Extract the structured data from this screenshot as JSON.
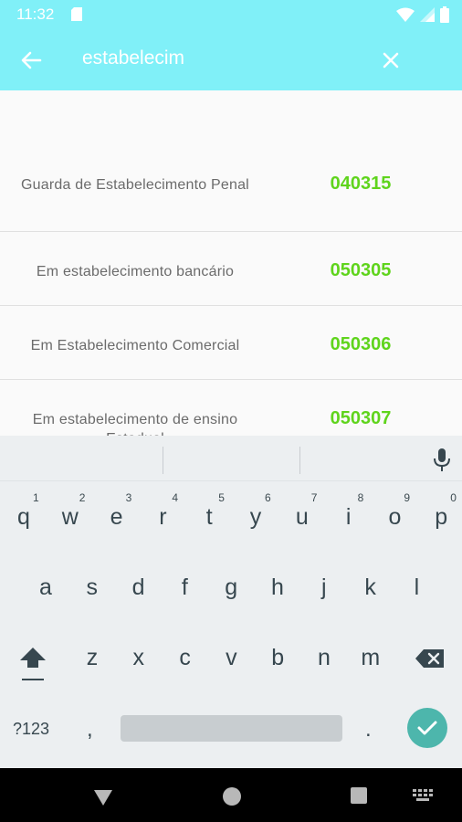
{
  "status_bar": {
    "time": "11:32",
    "icons": [
      "sd-card-icon",
      "wifi-icon",
      "signal-icon",
      "battery-icon"
    ]
  },
  "app_bar": {
    "background_color": "#80f0f8",
    "search_query": "estabelecim",
    "back_icon": "arrow-back-icon",
    "clear_icon": "close-icon"
  },
  "results": [
    {
      "name": "Guarda de Estabelecimento Penal",
      "code": "040315"
    },
    {
      "name": "Em estabelecimento bancário",
      "code": "050305"
    },
    {
      "name": "Em Estabelecimento Comercial",
      "code": "050306"
    },
    {
      "name": "Em estabelecimento de ensino Estadual",
      "code": "050307"
    }
  ],
  "code_color": "#5fd41c",
  "keyboard": {
    "row1": [
      "q",
      "w",
      "e",
      "r",
      "t",
      "y",
      "u",
      "i",
      "o",
      "p"
    ],
    "row1_hints": [
      "1",
      "2",
      "3",
      "4",
      "5",
      "6",
      "7",
      "8",
      "9",
      "0"
    ],
    "row2": [
      "a",
      "s",
      "d",
      "f",
      "g",
      "h",
      "j",
      "k",
      "l"
    ],
    "row3": [
      "z",
      "x",
      "c",
      "v",
      "b",
      "n",
      "m"
    ],
    "symbols_label": "?123",
    "comma": ",",
    "period": ".",
    "enter_color": "#4db6ac"
  },
  "nav_bar": {
    "buttons": [
      "back-triangle-icon",
      "home-circle-icon",
      "recents-square-icon",
      "keyboard-switch-icon"
    ]
  }
}
